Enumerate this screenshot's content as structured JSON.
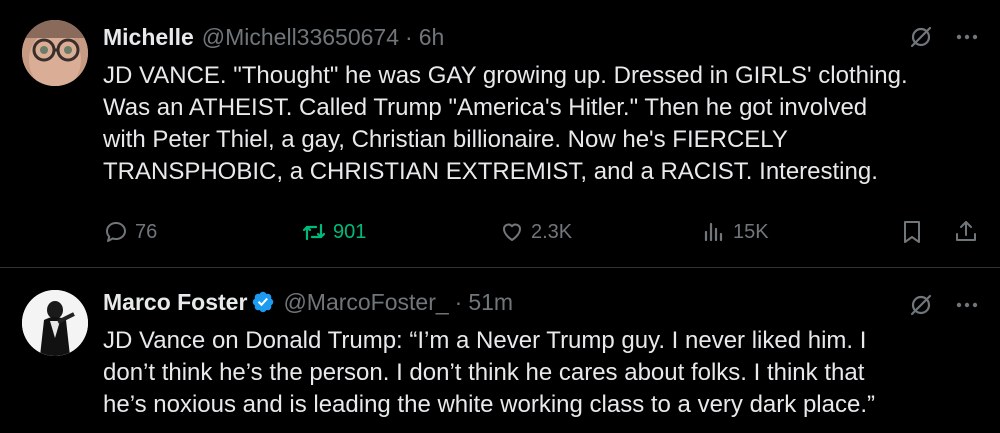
{
  "tweets": [
    {
      "name": "Michelle",
      "handle": "@Michell33650674",
      "separator": "·",
      "time": "6h",
      "lines": [
        "JD VANCE.  \"Thought\" he was GAY growing up.  Dressed in GIRLS' clothing.",
        "Was an ATHEIST.  Called Trump \"America's Hitler.\"  Then he got involved",
        "with Peter Thiel, a gay, Christian billionaire.  Now he's FIERCELY",
        "TRANSPHOBIC, a CHRISTIAN EXTREMIST, and a RACIST.  Interesting."
      ],
      "stats": {
        "replies": "76",
        "retweets": "901",
        "likes": "2.3K",
        "views": "15K"
      }
    },
    {
      "name": "Marco Foster",
      "handle": "@MarcoFoster_",
      "separator": "·",
      "time": "51m",
      "lines": [
        "JD Vance on Donald Trump: “I’m a Never Trump guy. I never liked him. I",
        "don’t think he’s the person. I don’t think he cares about folks. I think that",
        "he’s noxious and is leading the white working class to a very dark place.”"
      ]
    }
  ],
  "colors": {
    "background": "#000000",
    "text": "#e7e9ea",
    "muted": "#71767b",
    "retweet_active": "#00ba7c",
    "verified": "#1d9bf0",
    "divider": "#2f3336"
  },
  "icons": [
    "grok-icon",
    "more-icon",
    "reply-icon",
    "retweet-icon",
    "like-icon",
    "views-icon",
    "bookmark-icon",
    "share-icon",
    "verified-badge-icon"
  ]
}
